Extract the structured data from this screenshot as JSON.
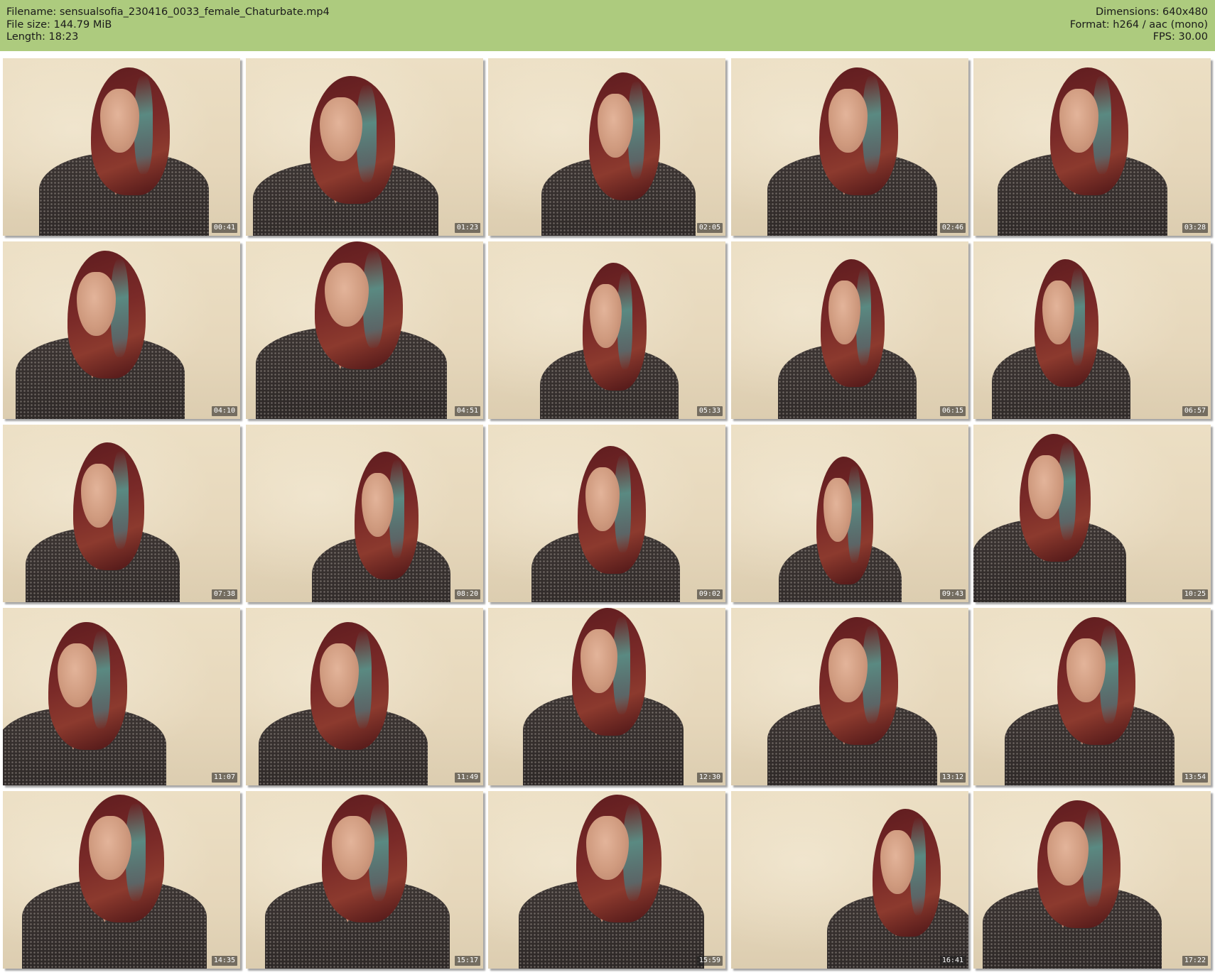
{
  "header": {
    "filename": "Filename: sensualsofia_230416_0033_female_Chaturbate.mp4",
    "filesize": "File size: 144.79 MiB",
    "length": "Length: 18:23",
    "dimensions": "Dimensions: 640x480",
    "format": "Format: h264 / aac (mono)",
    "fps": "FPS: 30.00",
    "background_color": "#adcb7e"
  },
  "thumbnails": [
    {
      "time": "00:41"
    },
    {
      "time": "01:23"
    },
    {
      "time": "02:05"
    },
    {
      "time": "02:46"
    },
    {
      "time": "03:28"
    },
    {
      "time": "04:10"
    },
    {
      "time": "04:51"
    },
    {
      "time": "05:33"
    },
    {
      "time": "06:15"
    },
    {
      "time": "06:57"
    },
    {
      "time": "07:38"
    },
    {
      "time": "08:20"
    },
    {
      "time": "09:02"
    },
    {
      "time": "09:43"
    },
    {
      "time": "10:25"
    },
    {
      "time": "11:07"
    },
    {
      "time": "11:49"
    },
    {
      "time": "12:30"
    },
    {
      "time": "13:12"
    },
    {
      "time": "13:54"
    },
    {
      "time": "14:35"
    },
    {
      "time": "15:17"
    },
    {
      "time": "15:59"
    },
    {
      "time": "16:41"
    },
    {
      "time": "17:22"
    }
  ]
}
